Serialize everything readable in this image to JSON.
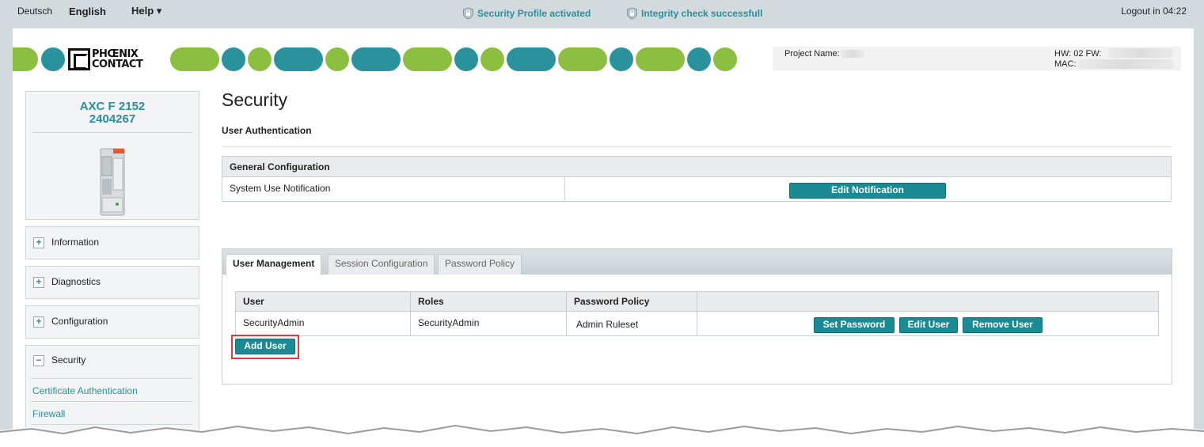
{
  "topbar": {
    "lang_de": "Deutsch",
    "lang_en": "English",
    "help": "Help ▾",
    "status_security": "Security Profile activated",
    "status_integrity": "Integrity check successfull",
    "logout": "Logout in 04:22"
  },
  "brand": {
    "logo_line1": "PHŒNIX",
    "logo_line2": "CONTACT",
    "green": "#8cbf3f",
    "teal": "#2a929c"
  },
  "project": {
    "name_label": "Project Name:",
    "hw_fw_label": "HW: 02 FW:",
    "mac_label": "MAC:"
  },
  "device": {
    "model": "AXC F 2152",
    "order_no": "2404267"
  },
  "sidebar": {
    "items": [
      {
        "label": "Information",
        "toggle": "+"
      },
      {
        "label": "Diagnostics",
        "toggle": "+"
      },
      {
        "label": "Configuration",
        "toggle": "+"
      }
    ],
    "security": {
      "label": "Security",
      "toggle": "−",
      "subitems": [
        "Certificate Authentication",
        "Firewall"
      ]
    }
  },
  "main": {
    "title": "Security",
    "subtitle": "User Authentication",
    "general": {
      "header": "General Configuration",
      "row_label": "System Use Notification",
      "button": "Edit Notification"
    },
    "tabs": [
      {
        "label": "User Management",
        "active": true
      },
      {
        "label": "Session Configuration",
        "active": false
      },
      {
        "label": "Password Policy",
        "active": false
      }
    ],
    "users_table": {
      "columns": [
        "User",
        "Roles",
        "Password Policy",
        ""
      ],
      "rows": [
        {
          "user": "SecurityAdmin",
          "roles": "SecurityAdmin",
          "policy": "Admin Ruleset"
        }
      ],
      "actions": {
        "set_password": "Set Password",
        "edit_user": "Edit User",
        "remove_user": "Remove User"
      }
    },
    "add_user": "Add User"
  }
}
